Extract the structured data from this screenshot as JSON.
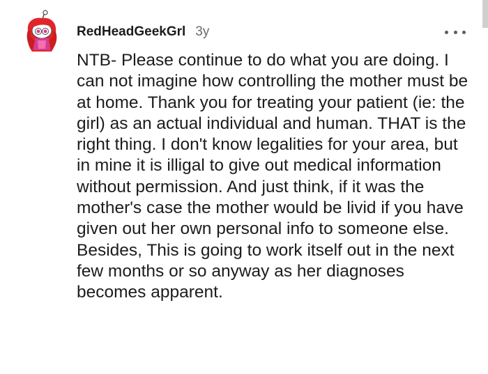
{
  "comment": {
    "username": "RedHeadGeekGrl",
    "age": "3y",
    "body": "NTB- Please continue to do what you are doing. I can not imagine how controlling the mother must be at home. Thank you for treating your patient (ie: the girl) as an actual individual and human. THAT is the right thing. I don't know legalities for your area, but in mine it is illigal to give out medical information without permission. And just think, if it was the mother's case the mother would be livid if you have given out her own personal info to someone else. Besides, This is going to work itself out in the next few months or so anyway as her diagnoses becomes apparent."
  },
  "icons": {
    "avatar": "snoo-avatar-icon",
    "more": "more-options-icon"
  },
  "colors": {
    "text": "#1c1c1c",
    "meta": "#6b6b6b",
    "avatar_hair": "#e0262b",
    "avatar_accent": "#d63c8f"
  }
}
